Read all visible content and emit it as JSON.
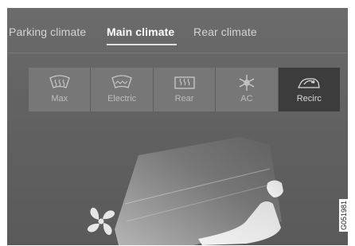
{
  "tabs": [
    {
      "label": "Parking climate"
    },
    {
      "label": "Main climate"
    },
    {
      "label": "Rear climate"
    }
  ],
  "buttons": [
    {
      "label": "Max",
      "icon": "max-defrost-icon"
    },
    {
      "label": "Electric",
      "icon": "electric-windshield-icon"
    },
    {
      "label": "Rear",
      "icon": "rear-defrost-icon"
    },
    {
      "label": "AC",
      "icon": "ac-snowflake-icon"
    },
    {
      "label": "Recirc",
      "icon": "recirculation-icon",
      "active": true
    }
  ],
  "watermark": "G051981",
  "colors": {
    "background": "#636363",
    "button": "#777777",
    "button_active": "#3c3c3c",
    "text": "#d4d4d4"
  }
}
